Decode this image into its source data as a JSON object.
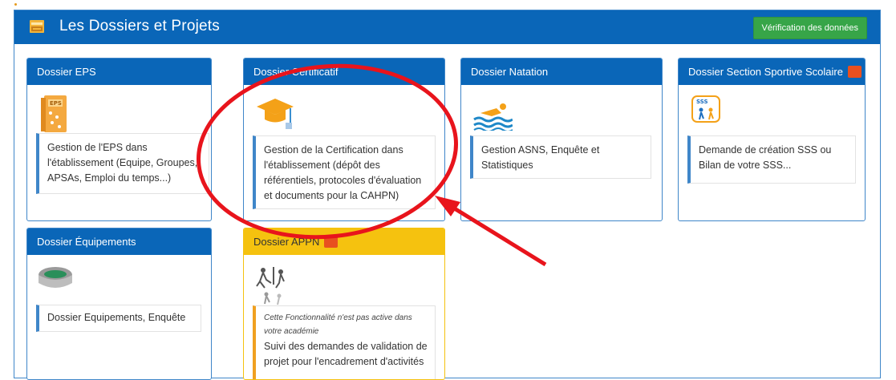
{
  "panel": {
    "title": "Les Dossiers et Projets",
    "verify_button": "Vérification des données"
  },
  "cards": {
    "eps": {
      "title": "Dossier EPS",
      "description": "Gestion de l'EPS dans l'établissement (Equipe, Groupes, APSAs, Emploi du temps...)",
      "icon": "eps-binder-icon"
    },
    "certificatif": {
      "title": "Dossier Certificatif",
      "description": "Gestion de la Certification dans l'établissement (dépôt des référentiels, protocoles d'évaluation et documents pour la CAHPN)",
      "icon": "graduation-cap-icon"
    },
    "natation": {
      "title": "Dossier Natation",
      "description": "Gestion ASNS, Enquête et Statistiques",
      "icon": "swimmer-icon"
    },
    "sss": {
      "title": "Dossier Section Sportive Scolaire",
      "description": "Demande de création SSS ou Bilan de votre SSS...",
      "icon": "sss-badge-icon",
      "badge_text": "SSS"
    },
    "equipements": {
      "title": "Dossier Équipements",
      "description": "Dossier Equipements, Enquête",
      "icon": "stadium-icon"
    },
    "appn": {
      "title": "Dossier APPN",
      "note": "Cette Fonctionnalité n'est pas active dans votre académie",
      "description": "Suivi des demandes de validation de projet pour l'encadrement d'activités",
      "icon": "outdoor-sports-icon"
    }
  },
  "colors": {
    "header_blue": "#0a66b8",
    "card_border": "#3f86c9",
    "appn_yellow": "#f5c20f",
    "verify_green": "#37a548",
    "annotation_red": "#e8141c"
  }
}
